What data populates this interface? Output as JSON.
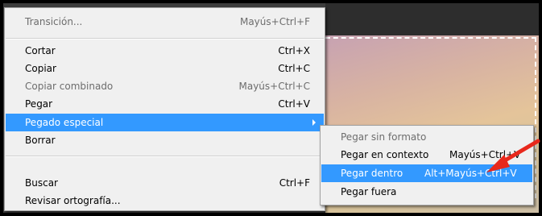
{
  "main_menu": {
    "items": [
      {
        "label": "Transición...",
        "shortcut": "Mayús+Ctrl+F",
        "state": "disabled"
      },
      {
        "label": "Cortar",
        "shortcut": "Ctrl+X",
        "state": "normal"
      },
      {
        "label": "Copiar",
        "shortcut": "Ctrl+C",
        "state": "normal"
      },
      {
        "label": "Copiar combinado",
        "shortcut": "Mayús+Ctrl+C",
        "state": "disabled"
      },
      {
        "label": "Pegar",
        "shortcut": "Ctrl+V",
        "state": "normal"
      },
      {
        "label": "Pegado especial",
        "shortcut": "",
        "state": "highlighted"
      },
      {
        "label": "Borrar",
        "shortcut": "",
        "state": "normal"
      },
      {
        "label": "Buscar",
        "shortcut": "Ctrl+F",
        "state": "normal"
      },
      {
        "label": "Revisar ortografía...",
        "shortcut": "",
        "state": "normal"
      }
    ]
  },
  "submenu": {
    "items": [
      {
        "label": "Pegar sin formato",
        "shortcut": "",
        "state": "disabled"
      },
      {
        "label": "Pegar en contexto",
        "shortcut": "Mayús+Ctrl+V",
        "state": "normal"
      },
      {
        "label": "Pegar dentro",
        "shortcut": "Alt+Mayús+Ctrl+V",
        "state": "highlighted"
      },
      {
        "label": "Pegar fuera",
        "shortcut": "",
        "state": "normal"
      }
    ]
  },
  "colors": {
    "highlight": "#3399ff",
    "menu_bg": "#f0f0f0",
    "annotation_arrow": "#e8281c"
  },
  "icons": {
    "submenu_indicator": "chevron-right-icon",
    "annotation": "red-arrow-annotation"
  }
}
